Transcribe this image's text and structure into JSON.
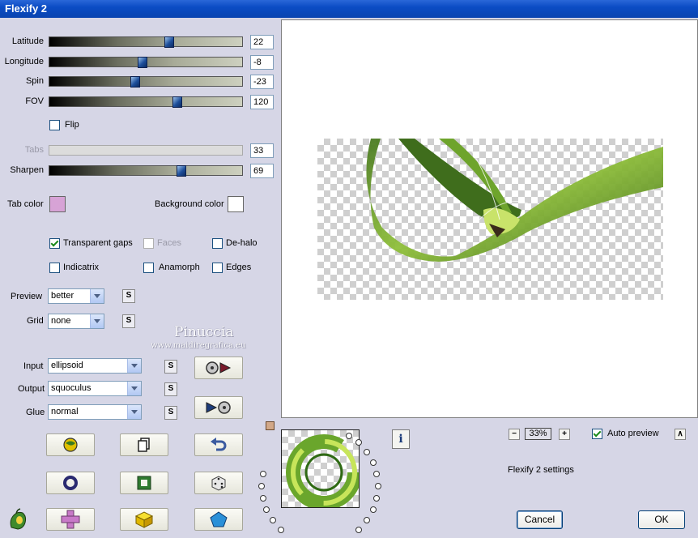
{
  "window": {
    "title": "Flexify 2"
  },
  "sliders": [
    {
      "label": "Latitude",
      "value": "22",
      "fraction": 0.62
    },
    {
      "label": "Longitude",
      "value": "-8",
      "fraction": 0.47
    },
    {
      "label": "Spin",
      "value": "-23",
      "fraction": 0.44
    },
    {
      "label": "FOV",
      "value": "120",
      "fraction": 0.66
    }
  ],
  "flip": {
    "label": "Flip",
    "checked": false
  },
  "tabs_slider": {
    "label": "Tabs",
    "value": "33"
  },
  "sharpen": {
    "label": "Sharpen",
    "value": "69",
    "fraction": 0.68
  },
  "colors": {
    "tab_color_label": "Tab color",
    "tab_color": "#d7a3d6",
    "background_color_label": "Background color",
    "background_color": "#ffffff"
  },
  "options": {
    "transparent_gaps": "Transparent gaps",
    "faces": "Faces",
    "de_halo": "De-halo",
    "indicatrix": "Indicatrix",
    "anamorph": "Anamorph",
    "edges": "Edges"
  },
  "preview": {
    "label": "Preview",
    "value": "better"
  },
  "grid": {
    "label": "Grid",
    "value": "none"
  },
  "watermark": {
    "name": "Pinuccia",
    "site": "www.maidiregrafica.eu"
  },
  "input": {
    "label": "Input",
    "value": "ellipsoid"
  },
  "output": {
    "label": "Output",
    "value": "squoculus"
  },
  "glue": {
    "label": "Glue",
    "value": "normal"
  },
  "s_label": "S",
  "zoom": {
    "value": "33%",
    "minus": "−",
    "plus": "+"
  },
  "auto_preview": {
    "label": "Auto preview",
    "checked": true,
    "button": "∧"
  },
  "status": "Flexify 2 settings",
  "buttons": {
    "cancel": "Cancel",
    "ok": "OK",
    "info": "i"
  },
  "accent_colors": {
    "title_bar": "#0b4cc4",
    "thumb": "#1d4e9a",
    "panel": "#d6d6e6"
  }
}
